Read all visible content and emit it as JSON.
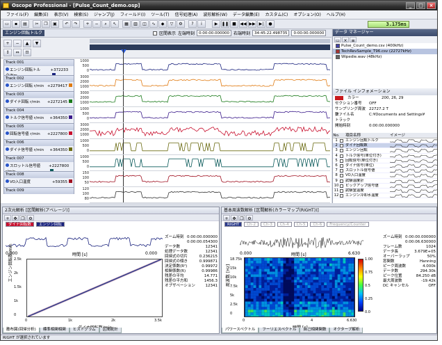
{
  "window": {
    "title": "Oscope Professional - [Pulse_Count_demo.osp]",
    "minimize": "_",
    "maximize": "□",
    "close": "×"
  },
  "menu": [
    "ファイル(F)",
    "編集(E)",
    "表示(V)",
    "検索(S)",
    "ジャンプ(J)",
    "フィールド(I)",
    "ツール(T)",
    "信号処理(A)",
    "波形解析(W)",
    "データ編集(E)",
    "カスタム(C)",
    "オプション(O)",
    "ヘルプ(H)"
  ],
  "toolbar": {
    "lcd": "3.175ms"
  },
  "subbar": {
    "group_label": "エンジン回転トルク",
    "check_label": "区間表示",
    "left_label": "左端時刻",
    "left_value": "0:00:00.000000",
    "right_label": "右端時刻",
    "right_value": "34:45:22.498735",
    "pos_value": "0:00:00.000000"
  },
  "tracks": [
    {
      "name": "Track 001",
      "label": "エンジン回転トルク/Nm",
      "value": "+372233",
      "color": "#1a237e",
      "axis": [
        "1000",
        "500",
        "0"
      ]
    },
    {
      "name": "Track 002",
      "label": "エンジン回転 r/min",
      "value": "+2279417",
      "color": "#e07a10",
      "axis": [
        "3000",
        "2000",
        "1000"
      ]
    },
    {
      "name": "Track 003",
      "label": "ダイナ回転 r/min",
      "value": "+2272145",
      "color": "#1a7a1a",
      "axis": [
        "3000",
        "2000",
        "1000"
      ]
    },
    {
      "name": "Track 004",
      "label": "トルク信号値 r/min",
      "value": "+364350",
      "color": "#3a1a8a",
      "axis": [
        "1000",
        "500",
        "0"
      ]
    },
    {
      "name": "Track 005",
      "label": "回転信号値 r/min",
      "value": "+2227800",
      "color": "#c8102e",
      "axis": [
        "3000",
        "2000",
        "1000"
      ]
    },
    {
      "name": "Track 006",
      "label": "ダイナ信号値 r/min",
      "value": "+364350",
      "color": "#6a6a10",
      "axis": [
        "1000",
        "500",
        "0"
      ]
    },
    {
      "name": "Track 007",
      "label": "スロットル信号値 r/min",
      "value": "+2227800",
      "color": "#0a5a5a",
      "axis": [
        "1000",
        "500",
        "0"
      ]
    },
    {
      "name": "Track 008",
      "label": "VO入口温度",
      "value": "+59355",
      "color": "#a01020",
      "axis": [
        "150",
        "100",
        "50"
      ]
    },
    {
      "name": "Track 009",
      "label": "",
      "value": "",
      "color": "#333333",
      "axis": [
        "120",
        "100",
        "80"
      ]
    }
  ],
  "data_manager": {
    "title": "データ マネージャー",
    "files": [
      {
        "name": "Pulse_Count_demo.csv (400kHz)",
        "selected": false,
        "color": "#4444aa"
      },
      {
        "name": "TechRevSample_T96.csv (22727kHz)",
        "selected": true,
        "color": "#aa3333"
      },
      {
        "name": "Wipedie.wav (48kHz)",
        "selected": false,
        "color": "#666666"
      }
    ]
  },
  "file_info": {
    "title": "ファイル インフォメーション",
    "rows": [
      {
        "k": "カラー",
        "v": "200, 26, 29"
      },
      {
        "k": "セクション番号",
        "v": "OFF"
      },
      {
        "k": "サンプリング周波数",
        "v": "22727.2 T"
      },
      {
        "k": "ファイル名",
        "v": "C:¥Documents and Settings¥"
      },
      {
        "k": "トラック",
        "v": ""
      },
      {
        "k": "開始時刻",
        "v": "0:00:00.000000"
      }
    ]
  },
  "item_list": {
    "head": [
      "No.",
      "項目名称",
      "イメージ"
    ],
    "rows": [
      {
        "no": "1",
        "name": "エンジン回転トルク",
        "sel": false
      },
      {
        "no": "2",
        "name": "ダイナ回転数",
        "sel": true
      },
      {
        "no": "3",
        "name": "エンジン回転",
        "sel": false
      },
      {
        "no": "4",
        "name": "トルク信号(単位付き)",
        "sel": false
      },
      {
        "no": "5",
        "name": "回転信号(単位付き)",
        "sel": false
      },
      {
        "no": "6",
        "name": "ダイナ信号(単位)",
        "sel": false
      },
      {
        "no": "7",
        "name": "スロットル信号値",
        "sel": false
      },
      {
        "no": "8",
        "name": "VO入口温度",
        "sel": false
      },
      {
        "no": "9",
        "name": "試験温度計",
        "sel": false
      },
      {
        "no": "10",
        "name": "ピックアップ信号値",
        "sel": false
      },
      {
        "no": "11",
        "name": "試験室温度",
        "sel": false
      },
      {
        "no": "12",
        "name": "エンジン冷却水温度",
        "sel": false
      }
    ]
  },
  "left_panel": {
    "title": "2次元解析 [区間解析(アベレージ)]",
    "chips": [
      "ダイナ回転数",
      "エンジン回転"
    ],
    "mini_xlabel": "時間 [s]",
    "mini_x": [
      "0.000",
      "0.000"
    ],
    "xy_xlabel": "ダイナ回転数/min",
    "xy_ylabel": "エンジン回転数/min",
    "xy_x": [
      "0",
      "1k",
      "2k",
      "3.5k"
    ],
    "xy_y": [
      "2.5k",
      "2k",
      "1.5k",
      "1k",
      "0"
    ],
    "stats": [
      [
        "ズーム時刻",
        "0:00:00.000000"
      ],
      [
        "",
        "0:00:00.054300"
      ],
      [
        "データ数",
        "12341"
      ],
      [
        "処理データ数",
        "12341"
      ],
      [
        "回帰式の切片",
        "0.236215"
      ],
      [
        "回帰式の傾き",
        "0.999871"
      ],
      [
        "決定係数(R²)",
        "0.99972"
      ],
      [
        "相関係数(R)",
        "0.99986"
      ],
      [
        "残差の平均",
        "14.771"
      ],
      [
        "残差の平方和",
        "1456.3"
      ],
      [
        "オブザベーション",
        "12341"
      ]
    ],
    "tabs": [
      "散布図(回帰分析)",
      "標準相関相関",
      "ヒストグラム",
      "区間統計"
    ]
  },
  "right_panel": {
    "title": "基本周波数解析 [区間解析(カラーマップ(RIGHT))]",
    "chips": [
      "RIGHT",
      "Ch-2",
      "Ch-3",
      "Ch-4",
      "Ch-5",
      "Ch-6",
      "Frequency/Counter"
    ],
    "mini_xlabel": "時間 [s]",
    "mini_x": [
      "0.000",
      "6.630"
    ],
    "map_xlabel": "時間 [s]",
    "map_ylabel": "周波数 [Hz]",
    "map_x": [
      "0",
      "4",
      "6.630"
    ],
    "map_y": [
      "18.75k",
      "15k",
      "10k",
      "7.5k",
      "5k",
      "2.5k",
      "0"
    ],
    "scale": [
      "1.00",
      "0.75",
      "0.5",
      "0.25",
      "0.0"
    ],
    "stats": [
      [
        "ズーム時刻",
        "0:00:00.000000"
      ],
      [
        "",
        "0:00:06.630000"
      ],
      [
        "フレーム数",
        "1024"
      ],
      [
        "データ長",
        "3.679E+05"
      ],
      [
        "オーバーラップ",
        "50%"
      ],
      [
        "窓関数",
        "Hanning"
      ],
      [
        "ピーク周波数",
        "4.000k"
      ],
      [
        "データ数",
        "294.30k"
      ],
      [
        "ピーク位置",
        "84.250 dB"
      ],
      [
        "最大周波数",
        "-19.42k"
      ],
      [
        "DC キャンセル",
        "OFF"
      ]
    ],
    "tabs": [
      "パワースペクトル",
      "フーリエスペクトル",
      "自己相関関数",
      "オクターブ解析"
    ]
  },
  "status": "RIGHT が選択されています"
}
